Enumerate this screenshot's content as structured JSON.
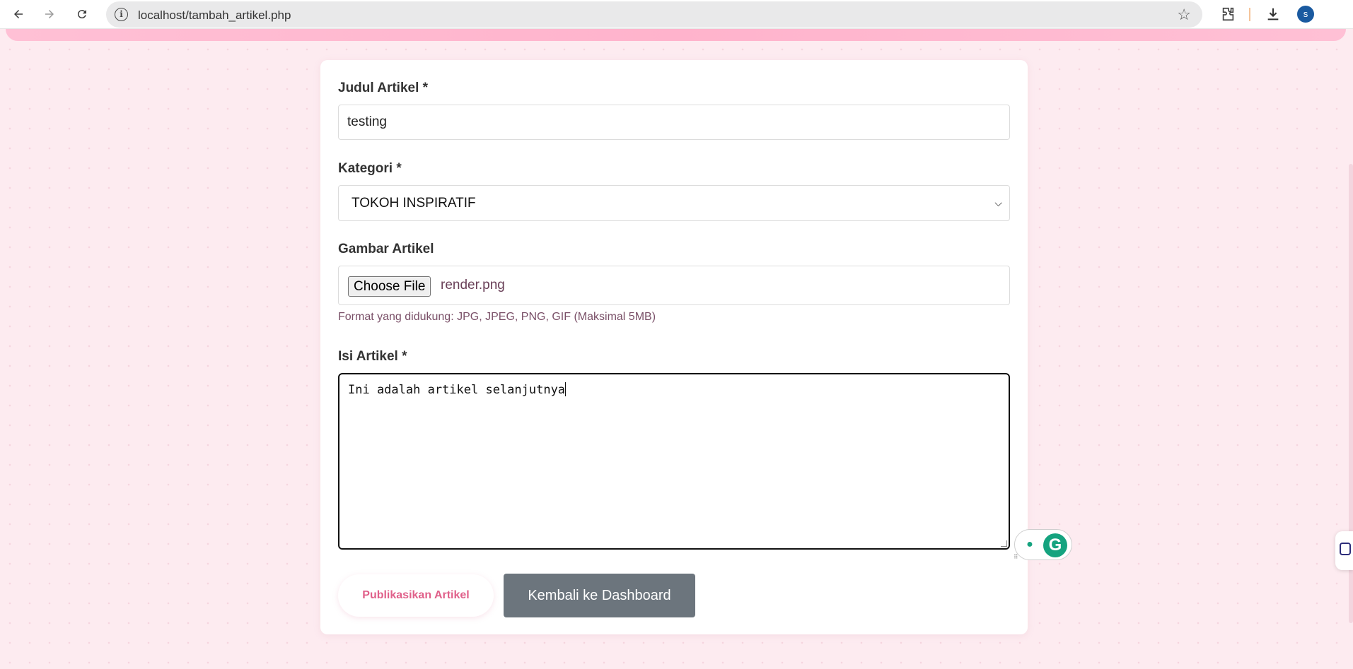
{
  "browser": {
    "url": "localhost/tambah_artikel.php",
    "profile_initial": "s",
    "back_icon": "arrow-left-icon",
    "forward_icon": "arrow-right-icon",
    "reload_icon": "reload-icon",
    "info_icon": "site-info-icon",
    "bookmark_icon": "star-icon",
    "extensions_icon": "puzzle-icon",
    "download_icon": "download-icon"
  },
  "form": {
    "title_label": "Judul Artikel *",
    "title_value": "testing",
    "category_label": "Kategori *",
    "category_value": "TOKOH INSPIRATIF",
    "image_label": "Gambar Artikel",
    "file_button": "Choose File",
    "file_name": "render.png",
    "image_hint": "Format yang didukung: JPG, JPEG, PNG, GIF (Maksimal 5MB)",
    "content_label": "Isi Artikel *",
    "content_value": "Ini adalah artikel selanjutnya"
  },
  "actions": {
    "publish_label": "Publikasikan Artikel",
    "back_label": "Kembali ke Dashboard"
  },
  "colors": {
    "background": "#fdebf0",
    "accent_pink": "#e0608a",
    "secondary_button": "#6c757d",
    "grammarly_green": "#15a37f"
  }
}
